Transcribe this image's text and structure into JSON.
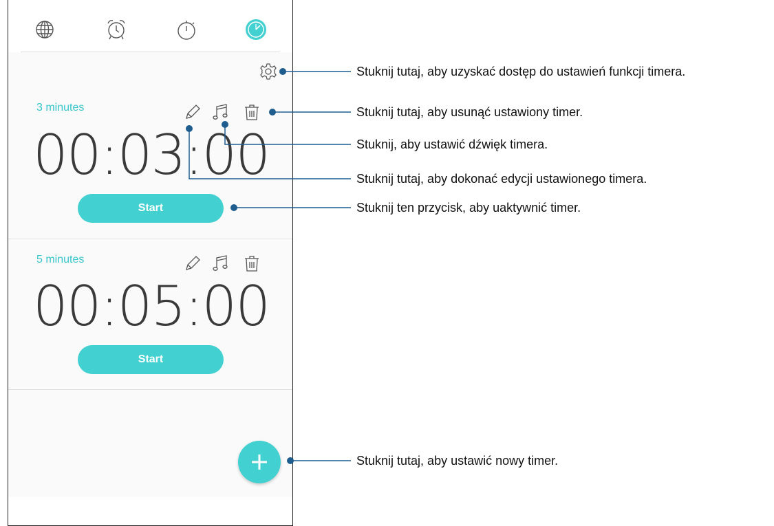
{
  "tabs": [
    {
      "name": "world-clock",
      "icon": "globe-icon"
    },
    {
      "name": "alarm",
      "icon": "alarm-clock-icon"
    },
    {
      "name": "stopwatch",
      "icon": "stopwatch-icon"
    },
    {
      "name": "timer",
      "icon": "timer-icon",
      "active": true
    }
  ],
  "colors": {
    "accent": "#43d0d1",
    "title": "#37c5cc",
    "callout_line": "#1f5d8f"
  },
  "timers": [
    {
      "title": "3 minutes",
      "time": "00:03:00",
      "start_label": "Start"
    },
    {
      "title": "5 minutes",
      "time": "00:05:00",
      "start_label": "Start"
    }
  ],
  "card_icons": [
    "pencil-icon",
    "music-note-icon",
    "trash-icon"
  ],
  "fab": {
    "icon": "plus-icon"
  },
  "callouts": {
    "settings": "Stuknij tutaj, aby uzyskać dostęp do ustawień funkcji timera.",
    "delete": "Stuknij tutaj, aby usunąć ustawiony timer.",
    "sound": "Stuknij, aby ustawić dźwięk timera.",
    "edit": "Stuknij tutaj, aby dokonać edycji ustawionego timera.",
    "start": "Stuknij ten przycisk, aby uaktywnić timer.",
    "add": "Stuknij tutaj, aby ustawić nowy timer."
  }
}
